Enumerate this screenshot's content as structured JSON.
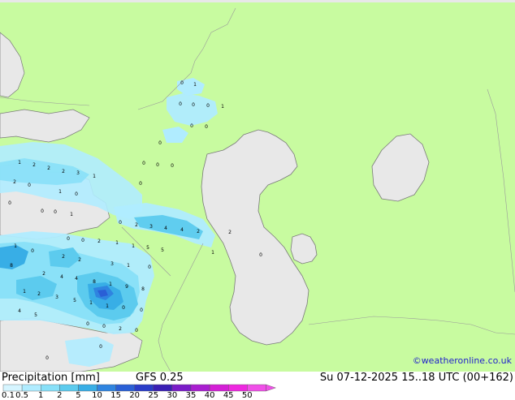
{
  "header": {
    "title": "Precipitation [mm]",
    "model": "GFS 0.25",
    "valid_time": "Su 07-12-2025 15..18 UTC (00+162)",
    "credit": "©weatheronline.co.uk"
  },
  "legend": {
    "ticks": [
      "0.1",
      "0.5",
      "1",
      "2",
      "5",
      "10",
      "15",
      "20",
      "25",
      "30",
      "35",
      "40",
      "45",
      "50"
    ],
    "colors": [
      "#d6f5ff",
      "#b0ecff",
      "#88e0f8",
      "#5ccbee",
      "#38aee6",
      "#2f84e0",
      "#2a5fd6",
      "#2a3cc8",
      "#3a1fb4",
      "#7a1cc8",
      "#a91ed0",
      "#d41fd6",
      "#ee28e0",
      "#f050e8"
    ]
  },
  "colors": {
    "land": "#c8fba0",
    "water": "#e8e8e8",
    "border": "#9a9a9a",
    "coast": "#7a7a7a"
  },
  "map": {
    "point_labels": [
      "0",
      "1",
      "0",
      "0",
      "0",
      "1",
      "0",
      "0",
      "0",
      "0",
      "0",
      "0",
      "1",
      "2",
      "2",
      "2",
      "3",
      "1",
      "2",
      "0",
      "0",
      "1",
      "0",
      "0",
      "0",
      "0",
      "1",
      "0",
      "2",
      "3",
      "4",
      "4",
      "2",
      "2",
      "1",
      "0",
      "0",
      "0",
      "2",
      "1",
      "1",
      "5",
      "5",
      "1",
      "0",
      "8",
      "2",
      "2",
      "3",
      "1",
      "0",
      "2",
      "4",
      "4",
      "8",
      "1",
      "9",
      "8",
      "1",
      "2",
      "3",
      "5",
      "1",
      "1",
      "0",
      "0",
      "4",
      "5",
      "0",
      "0",
      "2",
      "0",
      "0",
      "0"
    ]
  }
}
